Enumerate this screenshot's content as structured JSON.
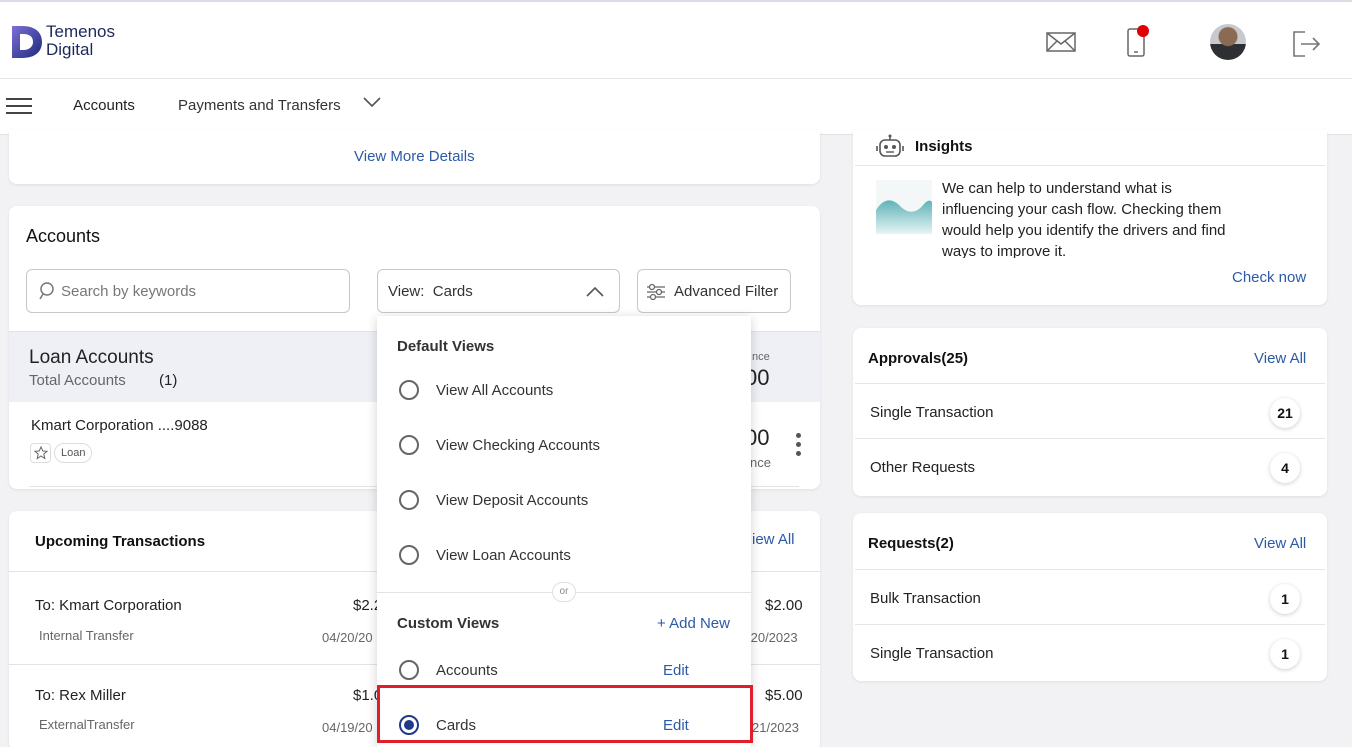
{
  "brand": {
    "line1": "Temenos",
    "line2": "Digital"
  },
  "nav": {
    "tabs": [
      "Accounts",
      "Payments and Transfers"
    ]
  },
  "details": {
    "view_more": "View More Details"
  },
  "accounts": {
    "title": "Accounts",
    "search_placeholder": "Search by keywords",
    "view_label": "View:",
    "view_value": "Cards",
    "advanced_filter": "Advanced Filter",
    "group": {
      "title": "Loan Accounts",
      "total_label": "Total Accounts",
      "total_count": "(1)",
      "balance_label_partial": "nce",
      "balance_value_partial": "00"
    },
    "row": {
      "name": "Kmart Corporation ....9088",
      "tag": "Loan",
      "balance_partial": "00",
      "balance_label_partial": "nce"
    }
  },
  "upcoming": {
    "title": "Upcoming Transactions",
    "view_all_partial": "iew All",
    "items": [
      {
        "to": "To: Kmart Corporation",
        "type": "Internal Transfer",
        "amount_partial": "$2.2",
        "date_partial": "04/20/20",
        "amount2": "$2.00",
        "date2_partial": "/20/2023"
      },
      {
        "to": "To: Rex Miller",
        "type": "ExternalTransfer",
        "amount_partial": "$1.0",
        "date_partial": "04/19/20",
        "amount2": "$5.00",
        "date2_partial": "21/2023"
      }
    ]
  },
  "dropdown": {
    "default_header": "Default Views",
    "default_options": [
      "View All Accounts",
      "View Checking Accounts",
      "View Deposit Accounts",
      "View Loan Accounts"
    ],
    "or": "or",
    "custom_header": "Custom Views",
    "add_new": "+ Add New",
    "custom_options": [
      {
        "label": "Accounts",
        "edit": "Edit",
        "selected": false
      },
      {
        "label": "Cards",
        "edit": "Edit",
        "selected": true
      }
    ]
  },
  "insights": {
    "title": "Insights",
    "text": "We can help to understand what is influencing your cash flow. Checking them would help you identify the drivers and find ways to improve it.",
    "cta": "Check now"
  },
  "approvals": {
    "title": "Approvals(25)",
    "view_all": "View All",
    "rows": [
      {
        "label": "Single Transaction",
        "count": "21"
      },
      {
        "label": "Other Requests",
        "count": "4"
      }
    ]
  },
  "requests": {
    "title": "Requests(2)",
    "view_all": "View All",
    "rows": [
      {
        "label": "Bulk Transaction",
        "count": "1"
      },
      {
        "label": "Single Transaction",
        "count": "1"
      }
    ]
  },
  "colors": {
    "accent_tab": "#2fc2a6",
    "link": "#2b5aa6",
    "radio_selected": "#1f3a8a",
    "highlight": "#e01e2a",
    "notify": "#e00000"
  }
}
